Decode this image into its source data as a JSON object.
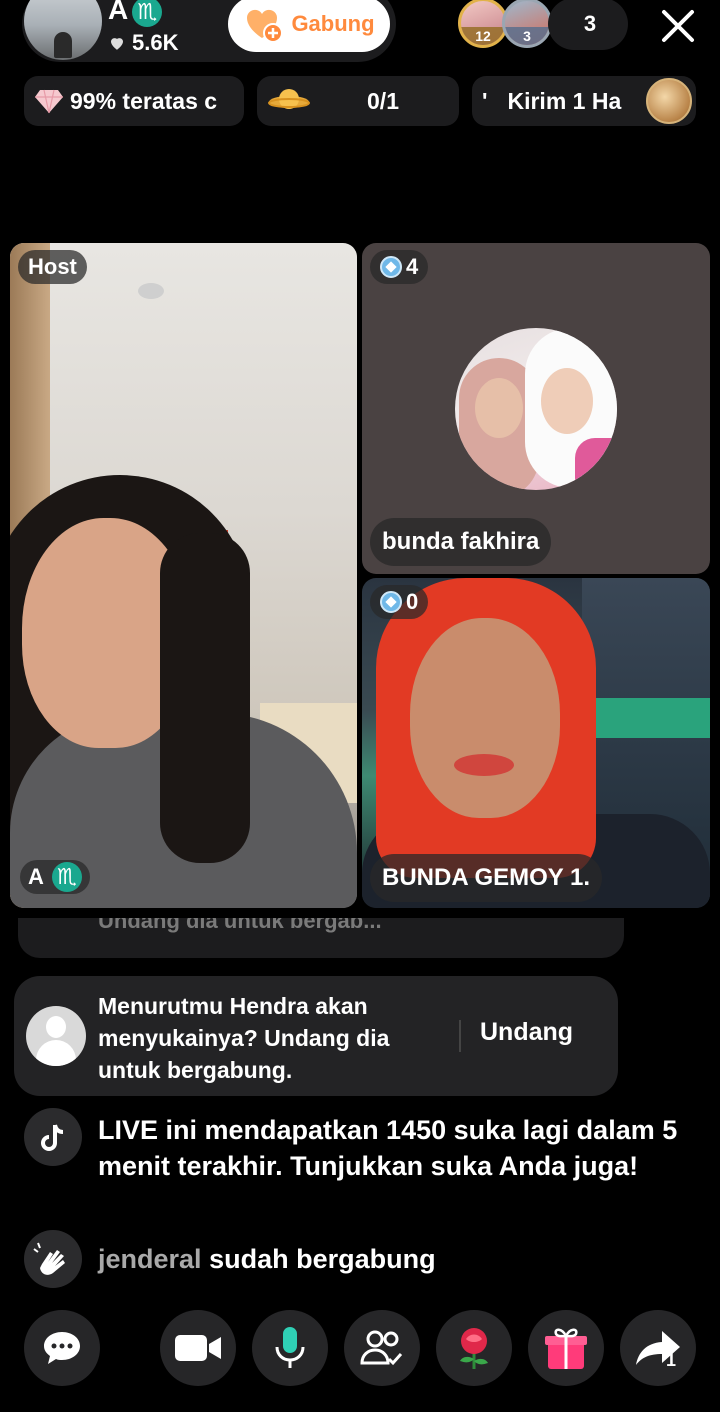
{
  "header": {
    "host_name": "A",
    "zodiac_symbol": "♏",
    "likes": "5.6K",
    "join_label": "Gabung",
    "viewers": [
      {
        "rank": "12"
      },
      {
        "rank": "3"
      }
    ],
    "viewer_count": "3"
  },
  "badges": {
    "rank_text": "99% teratas c",
    "goal_count": "0/1",
    "gift_quote": "'",
    "gift_text": "Kirim 1 Ha"
  },
  "grid": {
    "host_label": "Host",
    "host_name": "A",
    "guest1": {
      "count": "4",
      "name": "bunda fakhira"
    },
    "guest2": {
      "count": "0",
      "name": "BUNDA GEMOY 1."
    }
  },
  "comments": {
    "cut_text": "Undang dia untuk bergab...",
    "invite_text": "Menurutmu Hendra akan menyukainya? Undang dia untuk bergabung.",
    "invite_button": "Undang",
    "live_notice": "LIVE ini mendapatkan 1450 suka lagi dalam 5 menit terakhir. Tunjukkan suka Anda juga!",
    "join_user": "jenderal",
    "join_text": "sudah bergabung"
  },
  "bottom_bar": {
    "share_count": "1"
  },
  "colors": {
    "accent_orange": "#ff8a3d",
    "zodiac_teal": "#1aa88f",
    "gift_pink": "#ff3b7a"
  },
  "icons": [
    "heart-icon",
    "join-heart-icon",
    "close-icon",
    "diamond-icon",
    "planet-icon",
    "tiktok-icon",
    "wave-icon",
    "comment-icon",
    "video-icon",
    "mic-icon",
    "guests-icon",
    "rose-icon",
    "gift-icon",
    "share-icon"
  ]
}
